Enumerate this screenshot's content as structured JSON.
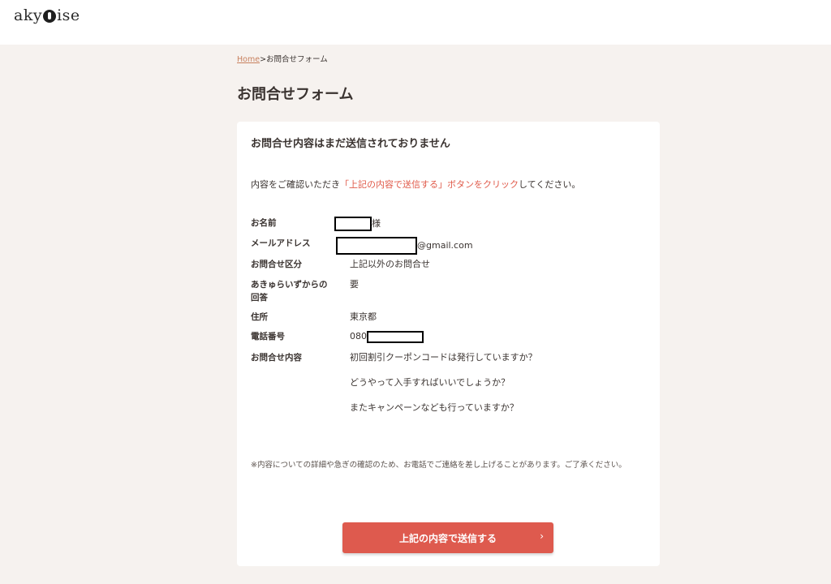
{
  "header": {
    "logo_left": "aky",
    "logo_right": "ise"
  },
  "breadcrumb": {
    "home": "Home",
    "separator": ">",
    "current": "お問合せフォーム"
  },
  "page_title": "お問合せフォーム",
  "card": {
    "title": "お問合せ内容はまだ送信されておりません",
    "instruction_before": "内容をご確認いただき",
    "instruction_highlight": "「上記の内容で送信する」ボタンをクリック",
    "instruction_after": "してください。",
    "fields": {
      "name": {
        "label": "お名前",
        "suffix": "様"
      },
      "email": {
        "label": "メールアドレス",
        "suffix": "@gmail.com"
      },
      "category": {
        "label": "お問合せ区分",
        "value": "上記以外のお問合せ"
      },
      "reply": {
        "label": "あきゅらいずからの回答",
        "value": "要"
      },
      "address": {
        "label": "住所",
        "value": "東京都"
      },
      "phone": {
        "label": "電話番号",
        "prefix": "080"
      },
      "content": {
        "label": "お問合せ内容",
        "lines": [
          "初回割引クーポンコードは発行していますか？",
          "どうやって入手すればいいでしょうか？",
          "またキャンペーンなども行っていますか？"
        ]
      }
    },
    "note": "※内容についての詳細や急ぎの確認のため、お電話でご連絡を差し上げることがあります。ご了承ください。",
    "submit_label": "上記の内容で送信する",
    "submit_chevron": "›"
  },
  "colors": {
    "accent": "#de5a4e",
    "highlight_text": "#e05a4a",
    "link": "#c8805e",
    "background": "#f6f2ef"
  }
}
